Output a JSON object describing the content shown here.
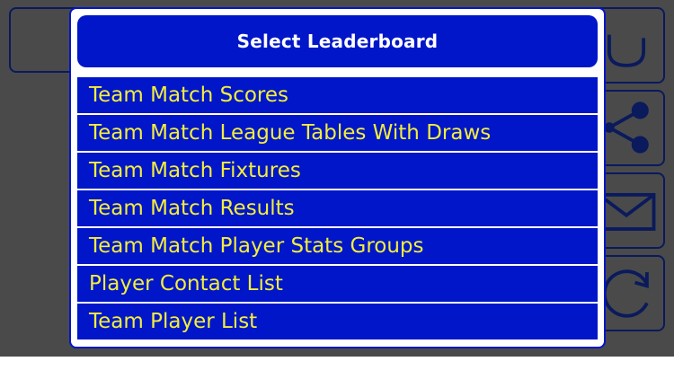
{
  "dialog": {
    "title": "Select Leaderboard",
    "items": [
      {
        "label": "Team Match Scores"
      },
      {
        "label": "Team Match League Tables With Draws"
      },
      {
        "label": "Team Match Fixtures"
      },
      {
        "label": "Team Match Results"
      },
      {
        "label": "Team Match Player Stats Groups"
      },
      {
        "label": "Player Contact List"
      },
      {
        "label": "Team Player List"
      }
    ]
  },
  "background": {
    "icons": [
      "undo-icon",
      "share-icon",
      "mail-icon",
      "refresh-icon"
    ]
  },
  "colors": {
    "dialog_blue": "#0016c8",
    "item_text": "#f3ee3a",
    "overlay": "#4a4a4a"
  }
}
